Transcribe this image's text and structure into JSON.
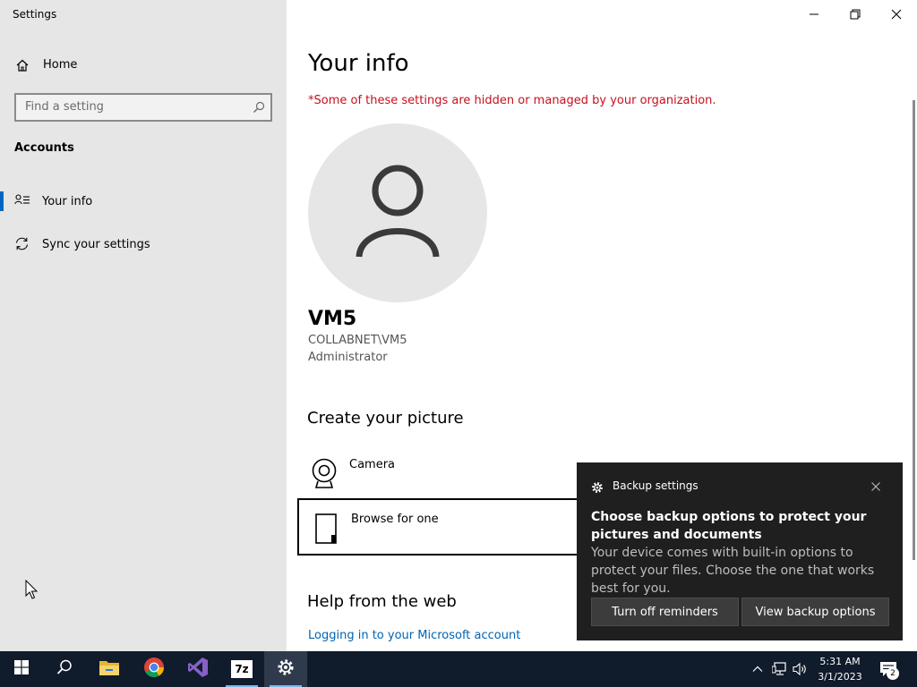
{
  "window": {
    "title": "Settings"
  },
  "sidebar": {
    "home_label": "Home",
    "search_placeholder": "Find a setting",
    "section_title": "Accounts",
    "items": [
      {
        "label": "Your info",
        "icon": "person-list-icon",
        "active": true
      },
      {
        "label": "Sync your settings",
        "icon": "sync-icon",
        "active": false
      }
    ]
  },
  "main": {
    "title": "Your info",
    "warning": "*Some of these settings are hidden or managed by your organization.",
    "user": {
      "name": "VM5",
      "domain": "COLLABNET\\VM5",
      "role": "Administrator"
    },
    "create_picture_heading": "Create your picture",
    "options": [
      {
        "label": "Camera",
        "icon": "camera-icon"
      },
      {
        "label": "Browse for one",
        "icon": "document-icon"
      }
    ],
    "help_heading": "Help from the web",
    "help_link": "Logging in to your Microsoft account"
  },
  "toast": {
    "app_name": "Backup settings",
    "headline": "Choose backup options to protect your pictures and documents",
    "body": "Your device comes with built-in options to protect your files. Choose the one that works best for you.",
    "button_left": "Turn off reminders",
    "button_right": "View backup options"
  },
  "taskbar": {
    "apps": [
      "start-icon",
      "search-icon",
      "file-explorer-icon",
      "chrome-icon",
      "visual-studio-icon",
      "7zip-icon",
      "settings-icon"
    ],
    "sevenzip_label": "7z",
    "time": "5:31 AM",
    "date": "3/1/2023",
    "notification_count": "2"
  },
  "colors": {
    "accent": "#0067c0",
    "warning": "#c50f1f",
    "link": "#0063b1",
    "taskbar": "#101b2b",
    "toast_bg": "#1f1f1f"
  }
}
